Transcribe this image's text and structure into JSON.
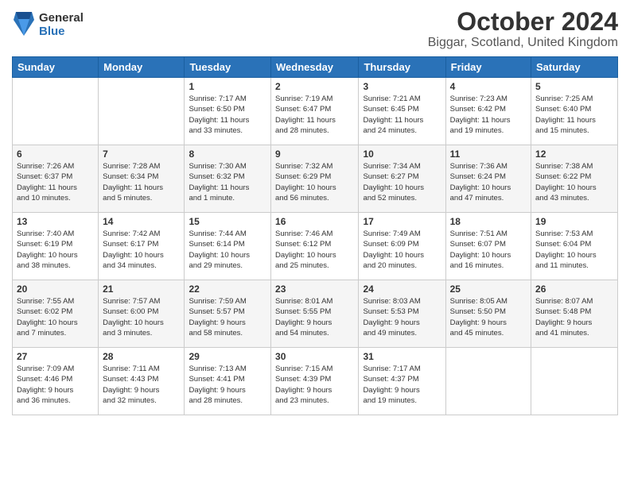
{
  "header": {
    "logo_general": "General",
    "logo_blue": "Blue",
    "month_title": "October 2024",
    "location": "Biggar, Scotland, United Kingdom"
  },
  "weekdays": [
    "Sunday",
    "Monday",
    "Tuesday",
    "Wednesday",
    "Thursday",
    "Friday",
    "Saturday"
  ],
  "weeks": [
    [
      {
        "day": "",
        "info": ""
      },
      {
        "day": "",
        "info": ""
      },
      {
        "day": "1",
        "info": "Sunrise: 7:17 AM\nSunset: 6:50 PM\nDaylight: 11 hours\nand 33 minutes."
      },
      {
        "day": "2",
        "info": "Sunrise: 7:19 AM\nSunset: 6:47 PM\nDaylight: 11 hours\nand 28 minutes."
      },
      {
        "day": "3",
        "info": "Sunrise: 7:21 AM\nSunset: 6:45 PM\nDaylight: 11 hours\nand 24 minutes."
      },
      {
        "day": "4",
        "info": "Sunrise: 7:23 AM\nSunset: 6:42 PM\nDaylight: 11 hours\nand 19 minutes."
      },
      {
        "day": "5",
        "info": "Sunrise: 7:25 AM\nSunset: 6:40 PM\nDaylight: 11 hours\nand 15 minutes."
      }
    ],
    [
      {
        "day": "6",
        "info": "Sunrise: 7:26 AM\nSunset: 6:37 PM\nDaylight: 11 hours\nand 10 minutes."
      },
      {
        "day": "7",
        "info": "Sunrise: 7:28 AM\nSunset: 6:34 PM\nDaylight: 11 hours\nand 5 minutes."
      },
      {
        "day": "8",
        "info": "Sunrise: 7:30 AM\nSunset: 6:32 PM\nDaylight: 11 hours\nand 1 minute."
      },
      {
        "day": "9",
        "info": "Sunrise: 7:32 AM\nSunset: 6:29 PM\nDaylight: 10 hours\nand 56 minutes."
      },
      {
        "day": "10",
        "info": "Sunrise: 7:34 AM\nSunset: 6:27 PM\nDaylight: 10 hours\nand 52 minutes."
      },
      {
        "day": "11",
        "info": "Sunrise: 7:36 AM\nSunset: 6:24 PM\nDaylight: 10 hours\nand 47 minutes."
      },
      {
        "day": "12",
        "info": "Sunrise: 7:38 AM\nSunset: 6:22 PM\nDaylight: 10 hours\nand 43 minutes."
      }
    ],
    [
      {
        "day": "13",
        "info": "Sunrise: 7:40 AM\nSunset: 6:19 PM\nDaylight: 10 hours\nand 38 minutes."
      },
      {
        "day": "14",
        "info": "Sunrise: 7:42 AM\nSunset: 6:17 PM\nDaylight: 10 hours\nand 34 minutes."
      },
      {
        "day": "15",
        "info": "Sunrise: 7:44 AM\nSunset: 6:14 PM\nDaylight: 10 hours\nand 29 minutes."
      },
      {
        "day": "16",
        "info": "Sunrise: 7:46 AM\nSunset: 6:12 PM\nDaylight: 10 hours\nand 25 minutes."
      },
      {
        "day": "17",
        "info": "Sunrise: 7:49 AM\nSunset: 6:09 PM\nDaylight: 10 hours\nand 20 minutes."
      },
      {
        "day": "18",
        "info": "Sunrise: 7:51 AM\nSunset: 6:07 PM\nDaylight: 10 hours\nand 16 minutes."
      },
      {
        "day": "19",
        "info": "Sunrise: 7:53 AM\nSunset: 6:04 PM\nDaylight: 10 hours\nand 11 minutes."
      }
    ],
    [
      {
        "day": "20",
        "info": "Sunrise: 7:55 AM\nSunset: 6:02 PM\nDaylight: 10 hours\nand 7 minutes."
      },
      {
        "day": "21",
        "info": "Sunrise: 7:57 AM\nSunset: 6:00 PM\nDaylight: 10 hours\nand 3 minutes."
      },
      {
        "day": "22",
        "info": "Sunrise: 7:59 AM\nSunset: 5:57 PM\nDaylight: 9 hours\nand 58 minutes."
      },
      {
        "day": "23",
        "info": "Sunrise: 8:01 AM\nSunset: 5:55 PM\nDaylight: 9 hours\nand 54 minutes."
      },
      {
        "day": "24",
        "info": "Sunrise: 8:03 AM\nSunset: 5:53 PM\nDaylight: 9 hours\nand 49 minutes."
      },
      {
        "day": "25",
        "info": "Sunrise: 8:05 AM\nSunset: 5:50 PM\nDaylight: 9 hours\nand 45 minutes."
      },
      {
        "day": "26",
        "info": "Sunrise: 8:07 AM\nSunset: 5:48 PM\nDaylight: 9 hours\nand 41 minutes."
      }
    ],
    [
      {
        "day": "27",
        "info": "Sunrise: 7:09 AM\nSunset: 4:46 PM\nDaylight: 9 hours\nand 36 minutes."
      },
      {
        "day": "28",
        "info": "Sunrise: 7:11 AM\nSunset: 4:43 PM\nDaylight: 9 hours\nand 32 minutes."
      },
      {
        "day": "29",
        "info": "Sunrise: 7:13 AM\nSunset: 4:41 PM\nDaylight: 9 hours\nand 28 minutes."
      },
      {
        "day": "30",
        "info": "Sunrise: 7:15 AM\nSunset: 4:39 PM\nDaylight: 9 hours\nand 23 minutes."
      },
      {
        "day": "31",
        "info": "Sunrise: 7:17 AM\nSunset: 4:37 PM\nDaylight: 9 hours\nand 19 minutes."
      },
      {
        "day": "",
        "info": ""
      },
      {
        "day": "",
        "info": ""
      }
    ]
  ]
}
